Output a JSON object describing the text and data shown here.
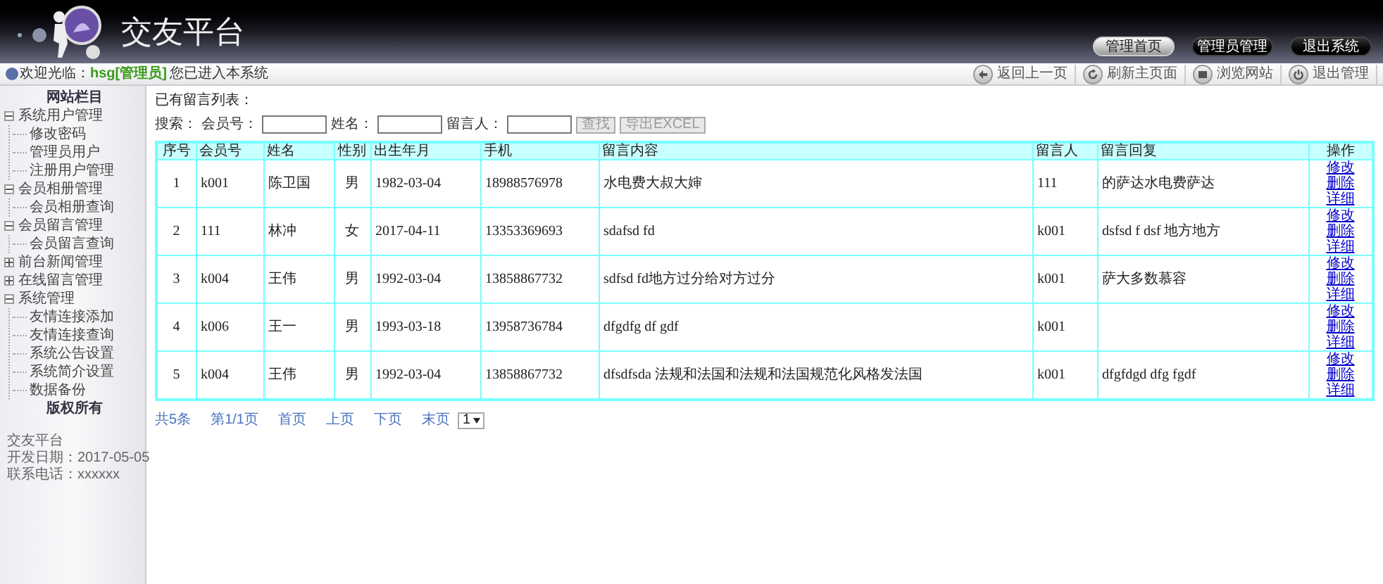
{
  "header": {
    "title": "交友平台",
    "nav": [
      {
        "label": "管理首页",
        "selected": true
      },
      {
        "label": "管理员管理",
        "selected": false
      },
      {
        "label": "退出系统",
        "selected": false
      }
    ]
  },
  "toolbar": {
    "welcome_prefix": "欢迎光临：",
    "user": "hsg[管理员]",
    "welcome_suffix": "您已进入本系统",
    "actions": [
      {
        "kind": "back",
        "label": "返回上一页"
      },
      {
        "kind": "refresh",
        "label": "刷新主页面"
      },
      {
        "kind": "browse",
        "label": "浏览网站"
      },
      {
        "kind": "power",
        "label": "退出管理"
      }
    ]
  },
  "sidebar": {
    "title": "网站栏目",
    "items": [
      {
        "label": "系统用户管理",
        "expanded": true,
        "children": [
          {
            "label": "修改密码"
          },
          {
            "label": "管理员用户"
          },
          {
            "label": "注册用户管理"
          }
        ]
      },
      {
        "label": "会员相册管理",
        "expanded": true,
        "children": [
          {
            "label": "会员相册查询"
          }
        ]
      },
      {
        "label": "会员留言管理",
        "expanded": true,
        "children": [
          {
            "label": "会员留言查询"
          }
        ]
      },
      {
        "label": "前台新闻管理",
        "expanded": false
      },
      {
        "label": "在线留言管理",
        "expanded": false
      },
      {
        "label": "系统管理",
        "expanded": true,
        "children": [
          {
            "label": "友情连接添加"
          },
          {
            "label": "友情连接查询"
          },
          {
            "label": "系统公告设置"
          },
          {
            "label": "系统简介设置"
          },
          {
            "label": "数据备份"
          }
        ]
      }
    ],
    "copyright": "版权所有",
    "info": [
      "交友平台",
      "开发日期：2017-05-05",
      "联系电话：xxxxxx"
    ]
  },
  "main": {
    "title": "已有留言列表：",
    "search": {
      "label": "搜索：",
      "fields": [
        {
          "label": "会员号："
        },
        {
          "label": "姓名："
        },
        {
          "label": "留言人："
        }
      ],
      "buttons": [
        "查找",
        "导出EXCEL"
      ]
    },
    "table": {
      "columns": [
        "序号",
        "会员号",
        "姓名",
        "性别",
        "出生年月",
        "手机",
        "留言内容",
        "留言人",
        "留言回复",
        "操作"
      ],
      "rows": [
        {
          "cells": [
            "1",
            "k001",
            "陈卫国",
            "男",
            "1982-03-04",
            "18988576978",
            "水电费大叔大婶",
            "111",
            "的萨达水电费萨达"
          ],
          "actions": [
            "修改",
            "删除",
            "详细"
          ]
        },
        {
          "cells": [
            "2",
            "111",
            "林冲",
            "女",
            "2017-04-11",
            "13353369693",
            "sdafsd fd",
            "k001",
            "dsfsd f dsf 地方地方"
          ],
          "actions": [
            "修改",
            "删除",
            "详细"
          ]
        },
        {
          "cells": [
            "3",
            "k004",
            "王伟",
            "男",
            "1992-03-04",
            "13858867732",
            "sdfsd fd地方过分给对方过分",
            "k001",
            "萨大多数慕容"
          ],
          "actions": [
            "修改",
            "删除",
            "详细"
          ]
        },
        {
          "cells": [
            "4",
            "k006",
            "王一",
            "男",
            "1993-03-18",
            "13958736784",
            "dfgdfg df gdf",
            "k001",
            ""
          ],
          "actions": [
            "修改",
            "删除",
            "详细"
          ]
        },
        {
          "cells": [
            "5",
            "k004",
            "王伟",
            "男",
            "1992-03-04",
            "13858867732",
            "dfsdfsda 法规和法国和法规和法国规范化风格发法国",
            "k001",
            "dfgfdgd dfg fgdf"
          ],
          "actions": [
            "修改",
            "删除",
            "详细"
          ]
        }
      ]
    },
    "pagination": {
      "links": [
        "共5条",
        "第1/1页",
        "首页",
        "上页",
        "下页",
        "末页"
      ],
      "page": "1"
    }
  }
}
